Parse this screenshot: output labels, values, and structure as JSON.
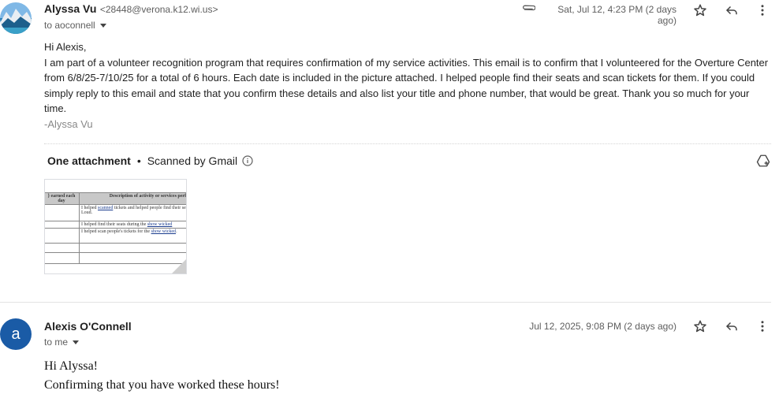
{
  "message1": {
    "sender_name": "Alyssa Vu",
    "sender_email": "<28448@verona.k12.wi.us>",
    "to_line": "to aoconnell",
    "date": "Sat, Jul 12, 4:23 PM (2 days ago)",
    "greeting": "Hi Alexis,",
    "body": "I am part of a volunteer recognition program that requires confirmation of my service activities. This email is to confirm that I volunteered for the Overture Center from 6/8/25-7/10/25 for a total of 6 hours. Each date is included in the picture attached. I helped people find their seats and scan tickets for them. If you could simply reply to this email and state that you confirm these details and also list your title and phone number, that would be great. Thank you so much for your time.",
    "signature": "-Alyssa Vu",
    "attachment_title": "One attachment",
    "attachment_dot": "•",
    "attachment_scan": "Scanned by Gmail",
    "thumbnail": {
      "col1_header": "} earned each day",
      "col2_header": "Description of activity or services performed. specific.",
      "row1_a": "I helped ",
      "row1_link": "scanned",
      "row1_b": " tickets and helped people find their seats for the show Move Out Loud.",
      "row2_a": "I helped find their seats during the ",
      "row2_link": "show wicked",
      "row3_a": "I helped scan people's tickets for the ",
      "row3_link": "show wicked",
      "row3_b": "."
    }
  },
  "message2": {
    "sender_name": "Alexis O'Connell",
    "avatar_letter": "a",
    "to_line": "to me",
    "date": "Jul 12, 2025, 9:08 PM (2 days ago)",
    "line1": "Hi Alyssa!",
    "line2": "Confirming that you have worked these hours!"
  },
  "icons": [
    "attachment-icon",
    "star-icon",
    "reply-icon",
    "more-vert-icon",
    "info-icon",
    "add-to-drive-icon",
    "chevron-down-icon"
  ],
  "colors": {
    "avatar_a": "#1a5ba6",
    "text_primary": "#1f1f1f",
    "text_secondary": "#5e5e5e"
  }
}
